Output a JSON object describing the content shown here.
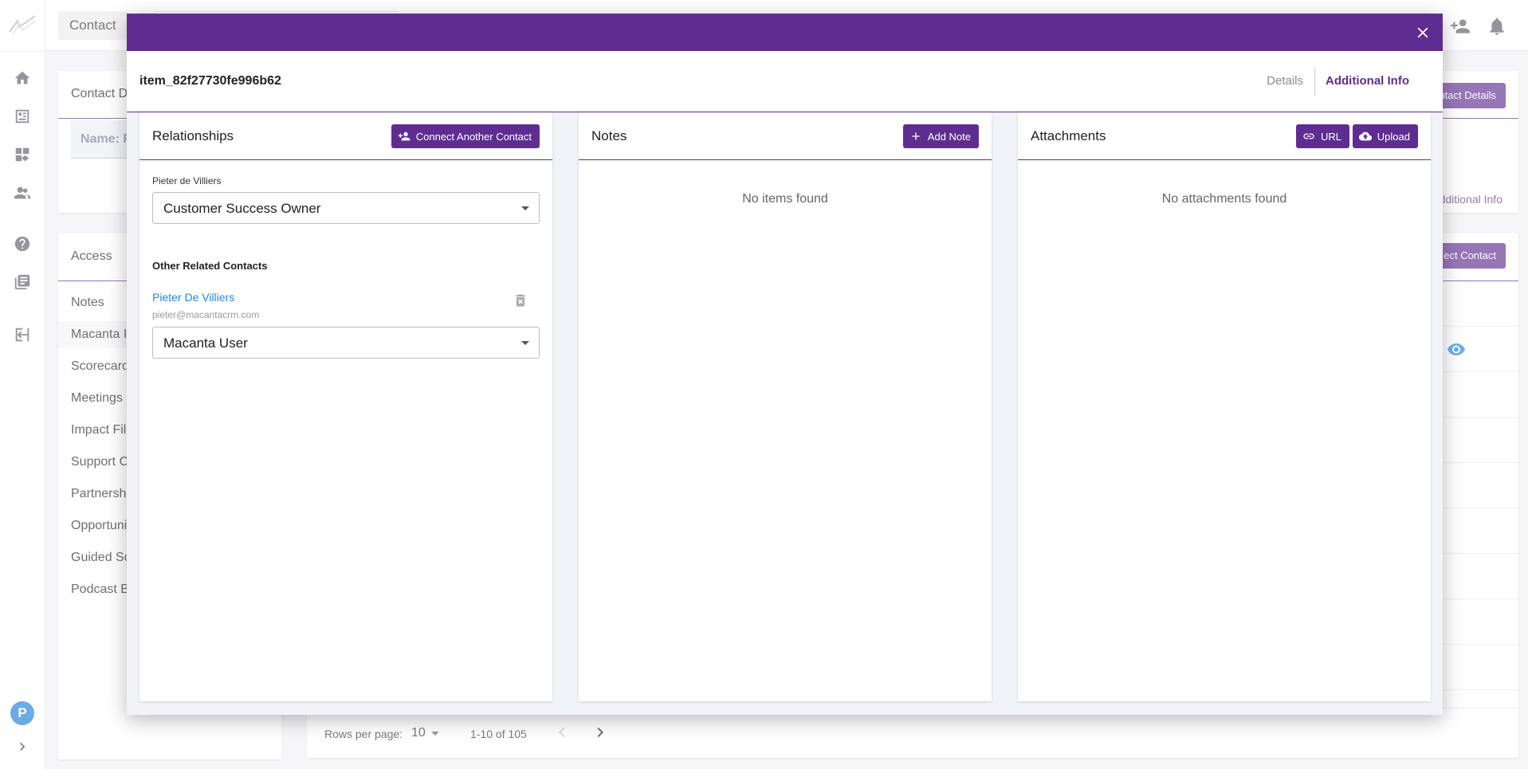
{
  "topbar": {
    "crumb": "Contact"
  },
  "background": {
    "contact_card_title": "Contact D",
    "name_label": "Name: F",
    "contact_details_button": "ntact Details",
    "additional_info_link": "dditional Info",
    "access_title": "Access",
    "connect_contact_button": "ect Contact",
    "nav_items": [
      "Notes",
      "Macanta I",
      "Scorecard",
      "Meetings",
      "Impact Fil",
      "Support C",
      "Partnersh",
      "Opportuni",
      "Guided Sc",
      "Podcast B"
    ]
  },
  "user": {
    "avatar_initial": "P"
  },
  "pager": {
    "rows_label": "Rows per page:",
    "rows_value": "10",
    "range": "1-10 of 105"
  },
  "modal": {
    "item_id": "item_82f27730fe996b62",
    "tabs": {
      "details": "Details",
      "additional_info": "Additional Info"
    },
    "relationships": {
      "title": "Relationships",
      "connect_button": "Connect Another Contact",
      "primary_contact_label": "Pieter de Villiers",
      "primary_role": "Customer Success Owner",
      "other_heading": "Other Related Contacts",
      "other_contact": {
        "name": "Pieter De Villiers",
        "email": "pieter@macantacrm.com",
        "role": "Macanta User"
      }
    },
    "notes": {
      "title": "Notes",
      "add_button": "Add Note",
      "empty": "No items found"
    },
    "attachments": {
      "title": "Attachments",
      "url_button": "URL",
      "upload_button": "Upload",
      "empty": "No attachments found"
    }
  },
  "colors": {
    "brand": "#5f2d91",
    "link": "#1e88e5",
    "avatar": "#1e7fd8"
  }
}
